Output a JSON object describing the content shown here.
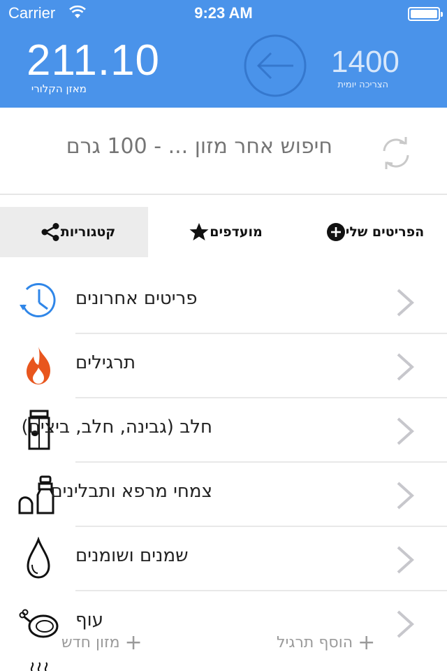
{
  "status_bar": {
    "carrier": "Carrier",
    "time": "9:23 AM"
  },
  "header": {
    "balance_value": "211.10",
    "balance_label": "מאזן הקלורי",
    "daily_value": "1400",
    "daily_label": "הצריכה יומית"
  },
  "search": {
    "placeholder": "חיפוש אחר מזון ... - 100 גרם"
  },
  "tabs": [
    {
      "label": "קטגוריות",
      "icon": "share-icon",
      "selected": true
    },
    {
      "label": "מועדפים",
      "icon": "star-icon",
      "selected": false
    },
    {
      "label": "הפריטים שלי",
      "icon": "plus-circle-icon",
      "selected": false
    }
  ],
  "categories": [
    {
      "label": "פריטים אחרונים",
      "icon": "recent-clock-icon"
    },
    {
      "label": "תרגילים",
      "icon": "flame-icon"
    },
    {
      "label": "חלב (גבינה, חלב, ביצים)",
      "icon": "milk-carton-icon"
    },
    {
      "label": "צמחי מרפא ותבלינים",
      "icon": "spice-grinder-icon"
    },
    {
      "label": "שמנים ושומנים",
      "icon": "oil-drop-icon"
    },
    {
      "label": "עוף",
      "icon": "chicken-icon"
    }
  ],
  "bottom_actions": {
    "add_food": "מזון חדש",
    "add_exercise": "הוסף תרגיל"
  },
  "colors": {
    "header_bg": "#4a93ea",
    "accent_blue": "#2f86e8",
    "flame": "#e8561e"
  }
}
